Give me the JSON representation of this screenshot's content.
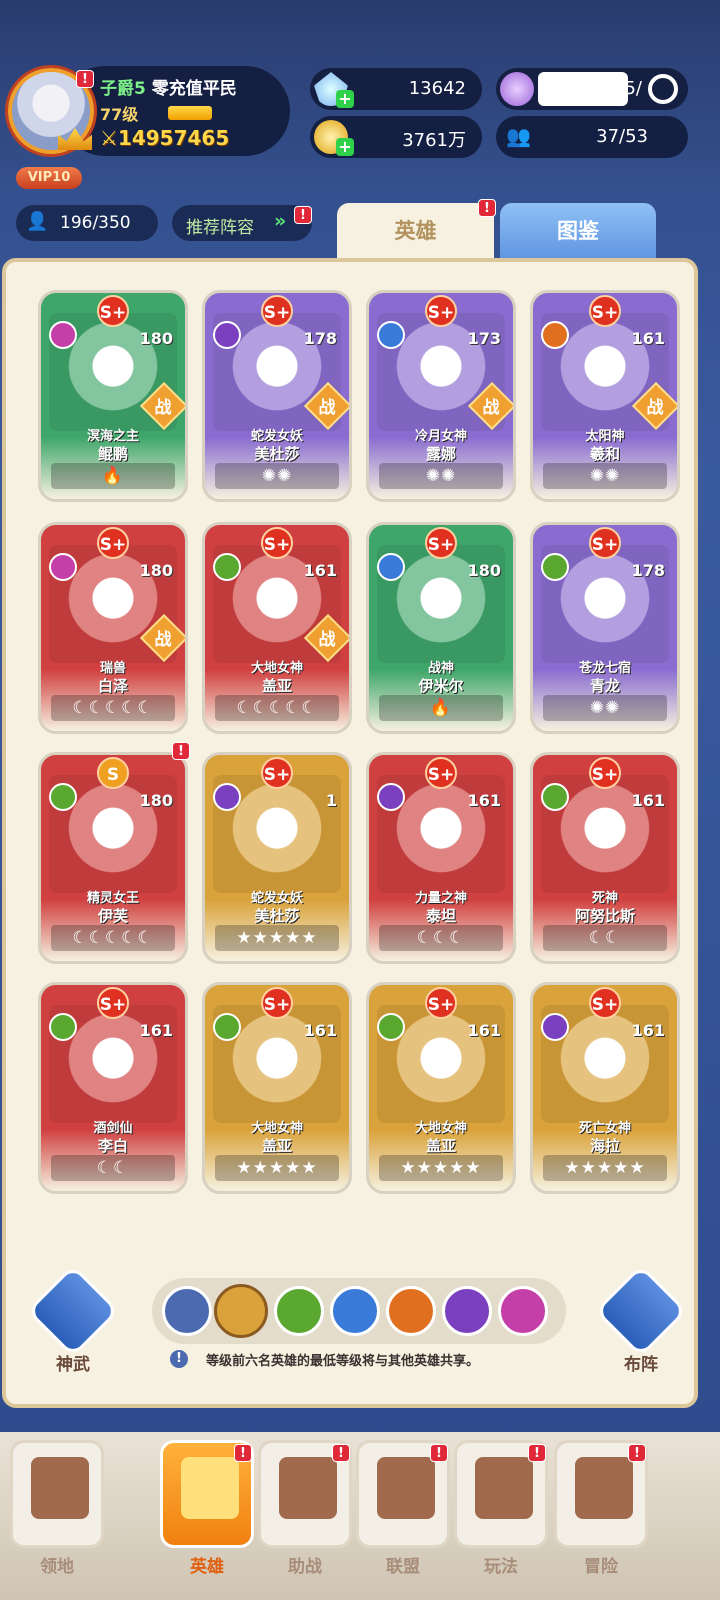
{
  "player": {
    "title": "子爵5",
    "status": "零充值平民",
    "level": "77级",
    "power": "14957465",
    "vip": "VIP10"
  },
  "resources": {
    "diamonds": "13642",
    "gold": "3761万",
    "energy": "285/",
    "guild_members": "37/53"
  },
  "roster": {
    "count": "196/350",
    "recommend": "推荐阵容"
  },
  "tabs": {
    "heroes": "英雄",
    "codex": "图鉴"
  },
  "heroes": [
    {
      "title": "溟海之主",
      "name": "鲲鹏",
      "level": "180",
      "badge": "S+",
      "zhan": "战",
      "stars": "🔥",
      "card_color": "#3fa66a",
      "element_color": "#c43fa8"
    },
    {
      "title": "蛇发女妖",
      "name": "美杜莎",
      "level": "178",
      "badge": "S+",
      "zhan": "战",
      "stars": "✺✺",
      "card_color": "#8a6cd0",
      "element_color": "#7a40c0"
    },
    {
      "title": "冷月女神",
      "name": "露娜",
      "level": "173",
      "badge": "S+",
      "zhan": "战",
      "stars": "✺✺",
      "card_color": "#8a6cd0",
      "element_color": "#3a7ad8"
    },
    {
      "title": "太阳神",
      "name": "羲和",
      "level": "161",
      "badge": "S+",
      "zhan": "战",
      "stars": "✺✺",
      "card_color": "#8a6cd0",
      "element_color": "#e07020"
    },
    {
      "title": "瑞兽",
      "name": "白泽",
      "level": "180",
      "badge": "S+",
      "zhan": "战",
      "stars": "☾☾☾☾☾",
      "card_color": "#d04040",
      "element_color": "#c43fa8"
    },
    {
      "title": "大地女神",
      "name": "盖亚",
      "level": "161",
      "badge": "S+",
      "zhan": "战",
      "stars": "☾☾☾☾☾",
      "card_color": "#d04040",
      "element_color": "#5aa830"
    },
    {
      "title": "战神",
      "name": "伊米尔",
      "level": "180",
      "badge": "S+",
      "zhan": "",
      "stars": "🔥",
      "card_color": "#3fa66a",
      "element_color": "#3a7ad8"
    },
    {
      "title": "苍龙七宿",
      "name": "青龙",
      "level": "178",
      "badge": "S+",
      "zhan": "",
      "stars": "✺✺",
      "card_color": "#8a6cd0",
      "element_color": "#5aa830"
    },
    {
      "title": "精灵女王",
      "name": "伊芙",
      "level": "180",
      "badge": "S",
      "zhan": "",
      "stars": "☾☾☾☾☾",
      "card_color": "#d04040",
      "element_color": "#5aa830"
    },
    {
      "title": "蛇发女妖",
      "name": "美杜莎",
      "level": "1",
      "badge": "S+",
      "zhan": "",
      "stars": "★★★★★",
      "card_color": "#d9a23a",
      "element_color": "#7a40c0"
    },
    {
      "title": "力量之神",
      "name": "泰坦",
      "level": "161",
      "badge": "S+",
      "zhan": "",
      "stars": "☾☾☾",
      "card_color": "#d04040",
      "element_color": "#7a40c0"
    },
    {
      "title": "死神",
      "name": "阿努比斯",
      "level": "161",
      "badge": "S+",
      "zhan": "",
      "stars": "☾☾",
      "card_color": "#d04040",
      "element_color": "#5aa830"
    },
    {
      "title": "酒剑仙",
      "name": "李白",
      "level": "161",
      "badge": "S+",
      "zhan": "",
      "stars": "☾☾",
      "card_color": "#d04040",
      "element_color": "#5aa830"
    },
    {
      "title": "大地女神",
      "name": "盖亚",
      "level": "161",
      "badge": "S+",
      "zhan": "",
      "stars": "★★★★★",
      "card_color": "#d9a23a",
      "element_color": "#5aa830"
    },
    {
      "title": "大地女神",
      "name": "盖亚",
      "level": "161",
      "badge": "S+",
      "zhan": "",
      "stars": "★★★★★",
      "card_color": "#d9a23a",
      "element_color": "#5aa830"
    },
    {
      "title": "死亡女神",
      "name": "海拉",
      "level": "161",
      "badge": "S+",
      "zhan": "",
      "stars": "★★★★★",
      "card_color": "#d9a23a",
      "element_color": "#7a40c0"
    }
  ],
  "bottom": {
    "shenwu": "神武",
    "buzhen": "布阵",
    "hint": "等级前六名英雄的最低等级将与其他英雄共享。"
  },
  "nav": [
    "领地",
    "英雄",
    "助战",
    "联盟",
    "玩法",
    "冒险"
  ]
}
